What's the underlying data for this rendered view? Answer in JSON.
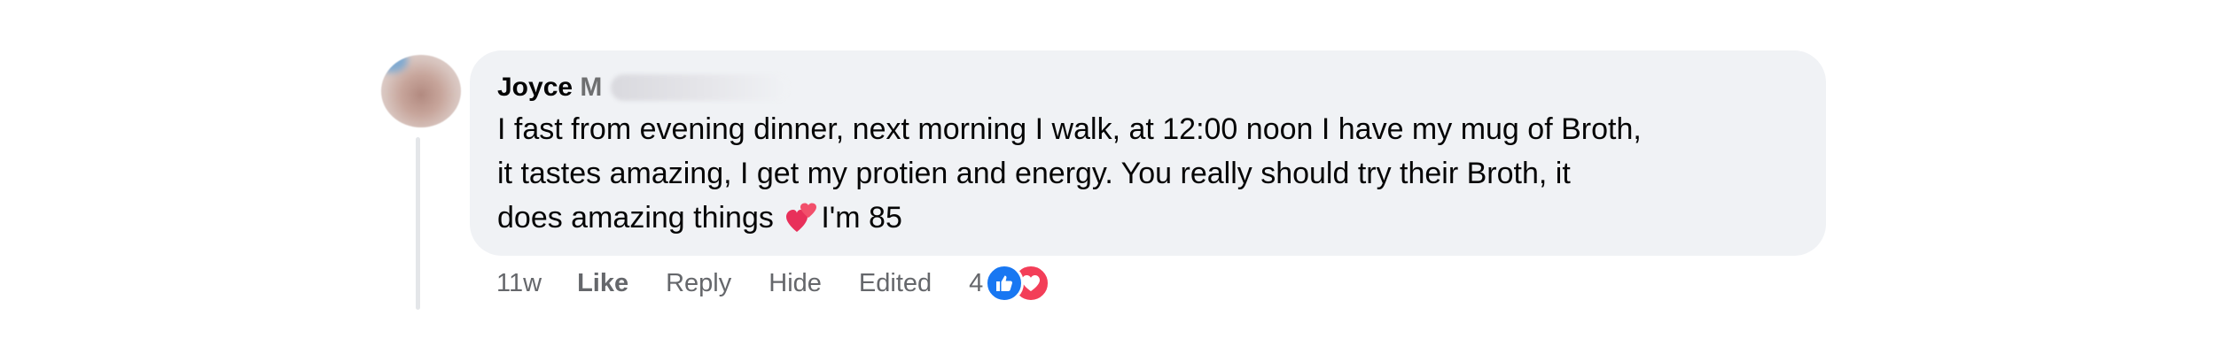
{
  "comment": {
    "author_first_name": "Joyce",
    "author_initial": "M",
    "text_lines": [
      "I fast from evening dinner, next morning I walk, at 12:00 noon I have my mug of Broth,",
      "it tastes amazing, I get my protien and energy. You really should try their Broth, it",
      "does amazing things"
    ],
    "text_after_emoji": "I'm 85",
    "emoji": "two-hearts"
  },
  "actions": {
    "timestamp": "11w",
    "like": "Like",
    "reply": "Reply",
    "hide": "Hide",
    "edited": "Edited",
    "reaction_count": "4",
    "reactions": [
      "like",
      "love"
    ]
  },
  "colors": {
    "bubble_bg": "#f0f2f5",
    "text": "#050505",
    "secondary_text": "#65676b",
    "like_blue": "#1877f2",
    "love_red": "#f33e58",
    "thread_line": "#e4e6e9"
  }
}
